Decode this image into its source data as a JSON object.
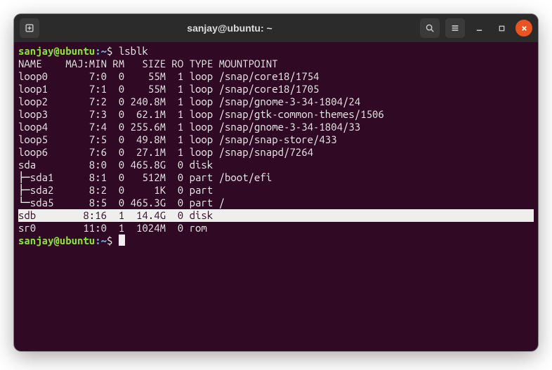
{
  "window": {
    "title": "sanjay@ubuntu: ~"
  },
  "prompt": {
    "userhost": "sanjay@ubuntu",
    "separator": ":",
    "path": "~",
    "symbol": "$"
  },
  "command": "lsblk",
  "header": {
    "name": "NAME",
    "majmin": "MAJ:MIN",
    "rm": "RM",
    "size": "SIZE",
    "ro": "RO",
    "type": "TYPE",
    "mount": "MOUNTPOINT"
  },
  "rows": [
    {
      "name": "loop0",
      "majmin": "7:0",
      "rm": "0",
      "size": "55M",
      "ro": "1",
      "type": "loop",
      "mount": "/snap/core18/1754",
      "hl": false
    },
    {
      "name": "loop1",
      "majmin": "7:1",
      "rm": "0",
      "size": "55M",
      "ro": "1",
      "type": "loop",
      "mount": "/snap/core18/1705",
      "hl": false
    },
    {
      "name": "loop2",
      "majmin": "7:2",
      "rm": "0",
      "size": "240.8M",
      "ro": "1",
      "type": "loop",
      "mount": "/snap/gnome-3-34-1804/24",
      "hl": false
    },
    {
      "name": "loop3",
      "majmin": "7:3",
      "rm": "0",
      "size": "62.1M",
      "ro": "1",
      "type": "loop",
      "mount": "/snap/gtk-common-themes/1506",
      "hl": false
    },
    {
      "name": "loop4",
      "majmin": "7:4",
      "rm": "0",
      "size": "255.6M",
      "ro": "1",
      "type": "loop",
      "mount": "/snap/gnome-3-34-1804/33",
      "hl": false
    },
    {
      "name": "loop5",
      "majmin": "7:5",
      "rm": "0",
      "size": "49.8M",
      "ro": "1",
      "type": "loop",
      "mount": "/snap/snap-store/433",
      "hl": false
    },
    {
      "name": "loop6",
      "majmin": "7:6",
      "rm": "0",
      "size": "27.1M",
      "ro": "1",
      "type": "loop",
      "mount": "/snap/snapd/7264",
      "hl": false
    },
    {
      "name": "sda",
      "majmin": "8:0",
      "rm": "0",
      "size": "465.8G",
      "ro": "0",
      "type": "disk",
      "mount": "",
      "hl": false
    },
    {
      "name": "├─sda1",
      "majmin": "8:1",
      "rm": "0",
      "size": "512M",
      "ro": "0",
      "type": "part",
      "mount": "/boot/efi",
      "hl": false
    },
    {
      "name": "├─sda2",
      "majmin": "8:2",
      "rm": "0",
      "size": "1K",
      "ro": "0",
      "type": "part",
      "mount": "",
      "hl": false
    },
    {
      "name": "└─sda5",
      "majmin": "8:5",
      "rm": "0",
      "size": "465.3G",
      "ro": "0",
      "type": "part",
      "mount": "/",
      "hl": false
    },
    {
      "name": "sdb",
      "majmin": "8:16",
      "rm": "1",
      "size": "14.4G",
      "ro": "0",
      "type": "disk",
      "mount": "",
      "hl": true
    },
    {
      "name": "sr0",
      "majmin": "11:0",
      "rm": "1",
      "size": "1024M",
      "ro": "0",
      "type": "rom",
      "mount": "",
      "hl": false
    }
  ],
  "colwidths": {
    "name": 7,
    "majmin": 7,
    "rm": 2,
    "size": 6,
    "ro": 2,
    "type": 4
  }
}
